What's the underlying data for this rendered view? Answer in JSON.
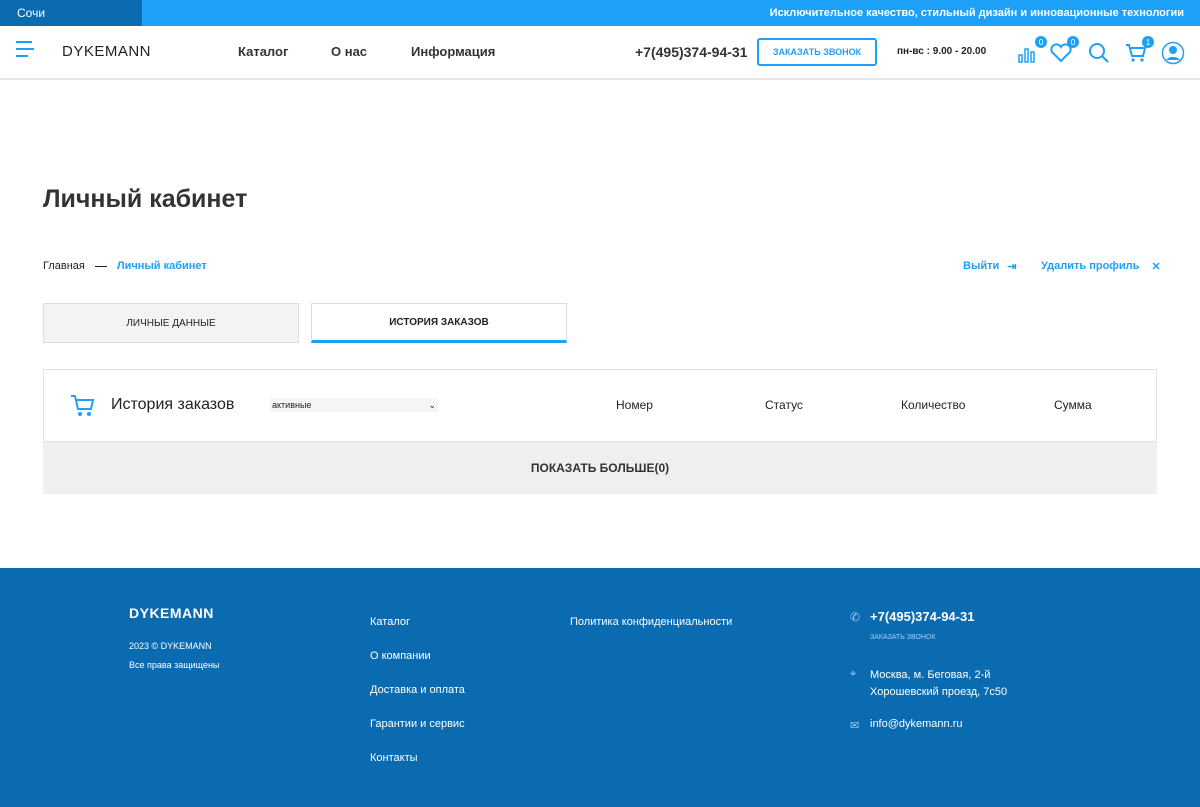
{
  "topbar": {
    "city": "Сочи",
    "slogan": "Исключительное качество, стильный дизайн и инновационные технологии"
  },
  "header": {
    "logo": "DYKEMANN",
    "nav": [
      "Каталог",
      "О нас",
      "Информация"
    ],
    "phone": "+7(495)374-94-31",
    "call_button": "ЗАКАЗАТЬ ЗВОНОК",
    "hours": "пн-вс : 9.00 - 20.00",
    "badges": {
      "compare": "0",
      "favorites": "0",
      "cart": "1"
    }
  },
  "page": {
    "title": "Личный кабинет",
    "breadcrumb": [
      "Главная",
      "Личный кабинет"
    ],
    "logout": "Выйти",
    "delete_profile": "Удалить профиль",
    "tabs": [
      "ЛИЧНЫЕ ДАННЫЕ",
      "ИСТОРИЯ ЗАКАЗОВ"
    ],
    "orders": {
      "title": "История заказов",
      "filter": "активные",
      "columns": [
        "Номер",
        "Статус",
        "Количество",
        "Сумма"
      ],
      "show_more": "ПОКАЗАТЬ БОЛЬШЕ(0)"
    }
  },
  "footer": {
    "logo": "DYKEMANN",
    "copyright": "2023 © DYKEMANN",
    "rights": "Все права защищены",
    "links": [
      "Каталог",
      "О компании",
      "Доставка и оплата",
      "Гарантии и сервис",
      "Контакты"
    ],
    "privacy": "Политика конфиденциальности",
    "phone": "+7(495)374-94-31",
    "call": "ЗАКАЗАТЬ ЗВОНОК",
    "address": "Москва, м. Беговая, 2-й Хорошевский проезд, 7с50",
    "email": "info@dykemann.ru"
  }
}
